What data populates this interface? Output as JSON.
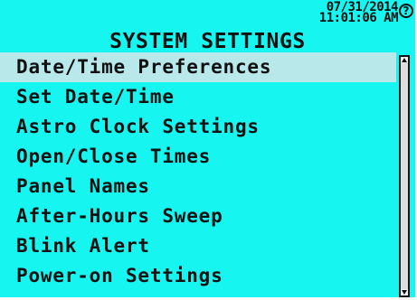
{
  "header": {
    "date": "07/31/2014",
    "time": "11:01:06 AM",
    "help_icon": "?"
  },
  "title": "SYSTEM SETTINGS",
  "menu": {
    "selected_index": 0,
    "items": [
      {
        "label": "Date/Time Preferences"
      },
      {
        "label": "Set Date/Time"
      },
      {
        "label": "Astro Clock Settings"
      },
      {
        "label": "Open/Close Times"
      },
      {
        "label": "Panel Names"
      },
      {
        "label": "After-Hours Sweep"
      },
      {
        "label": "Blink Alert"
      },
      {
        "label": "Power-on Settings"
      }
    ]
  },
  "colors": {
    "background": "#17f5f0",
    "selection": "#b8e8ea",
    "text": "#111111"
  },
  "icons": {
    "help": "question-circle-icon",
    "scroll_up": "triangle-up-icon",
    "scroll_down": "triangle-down-icon"
  }
}
